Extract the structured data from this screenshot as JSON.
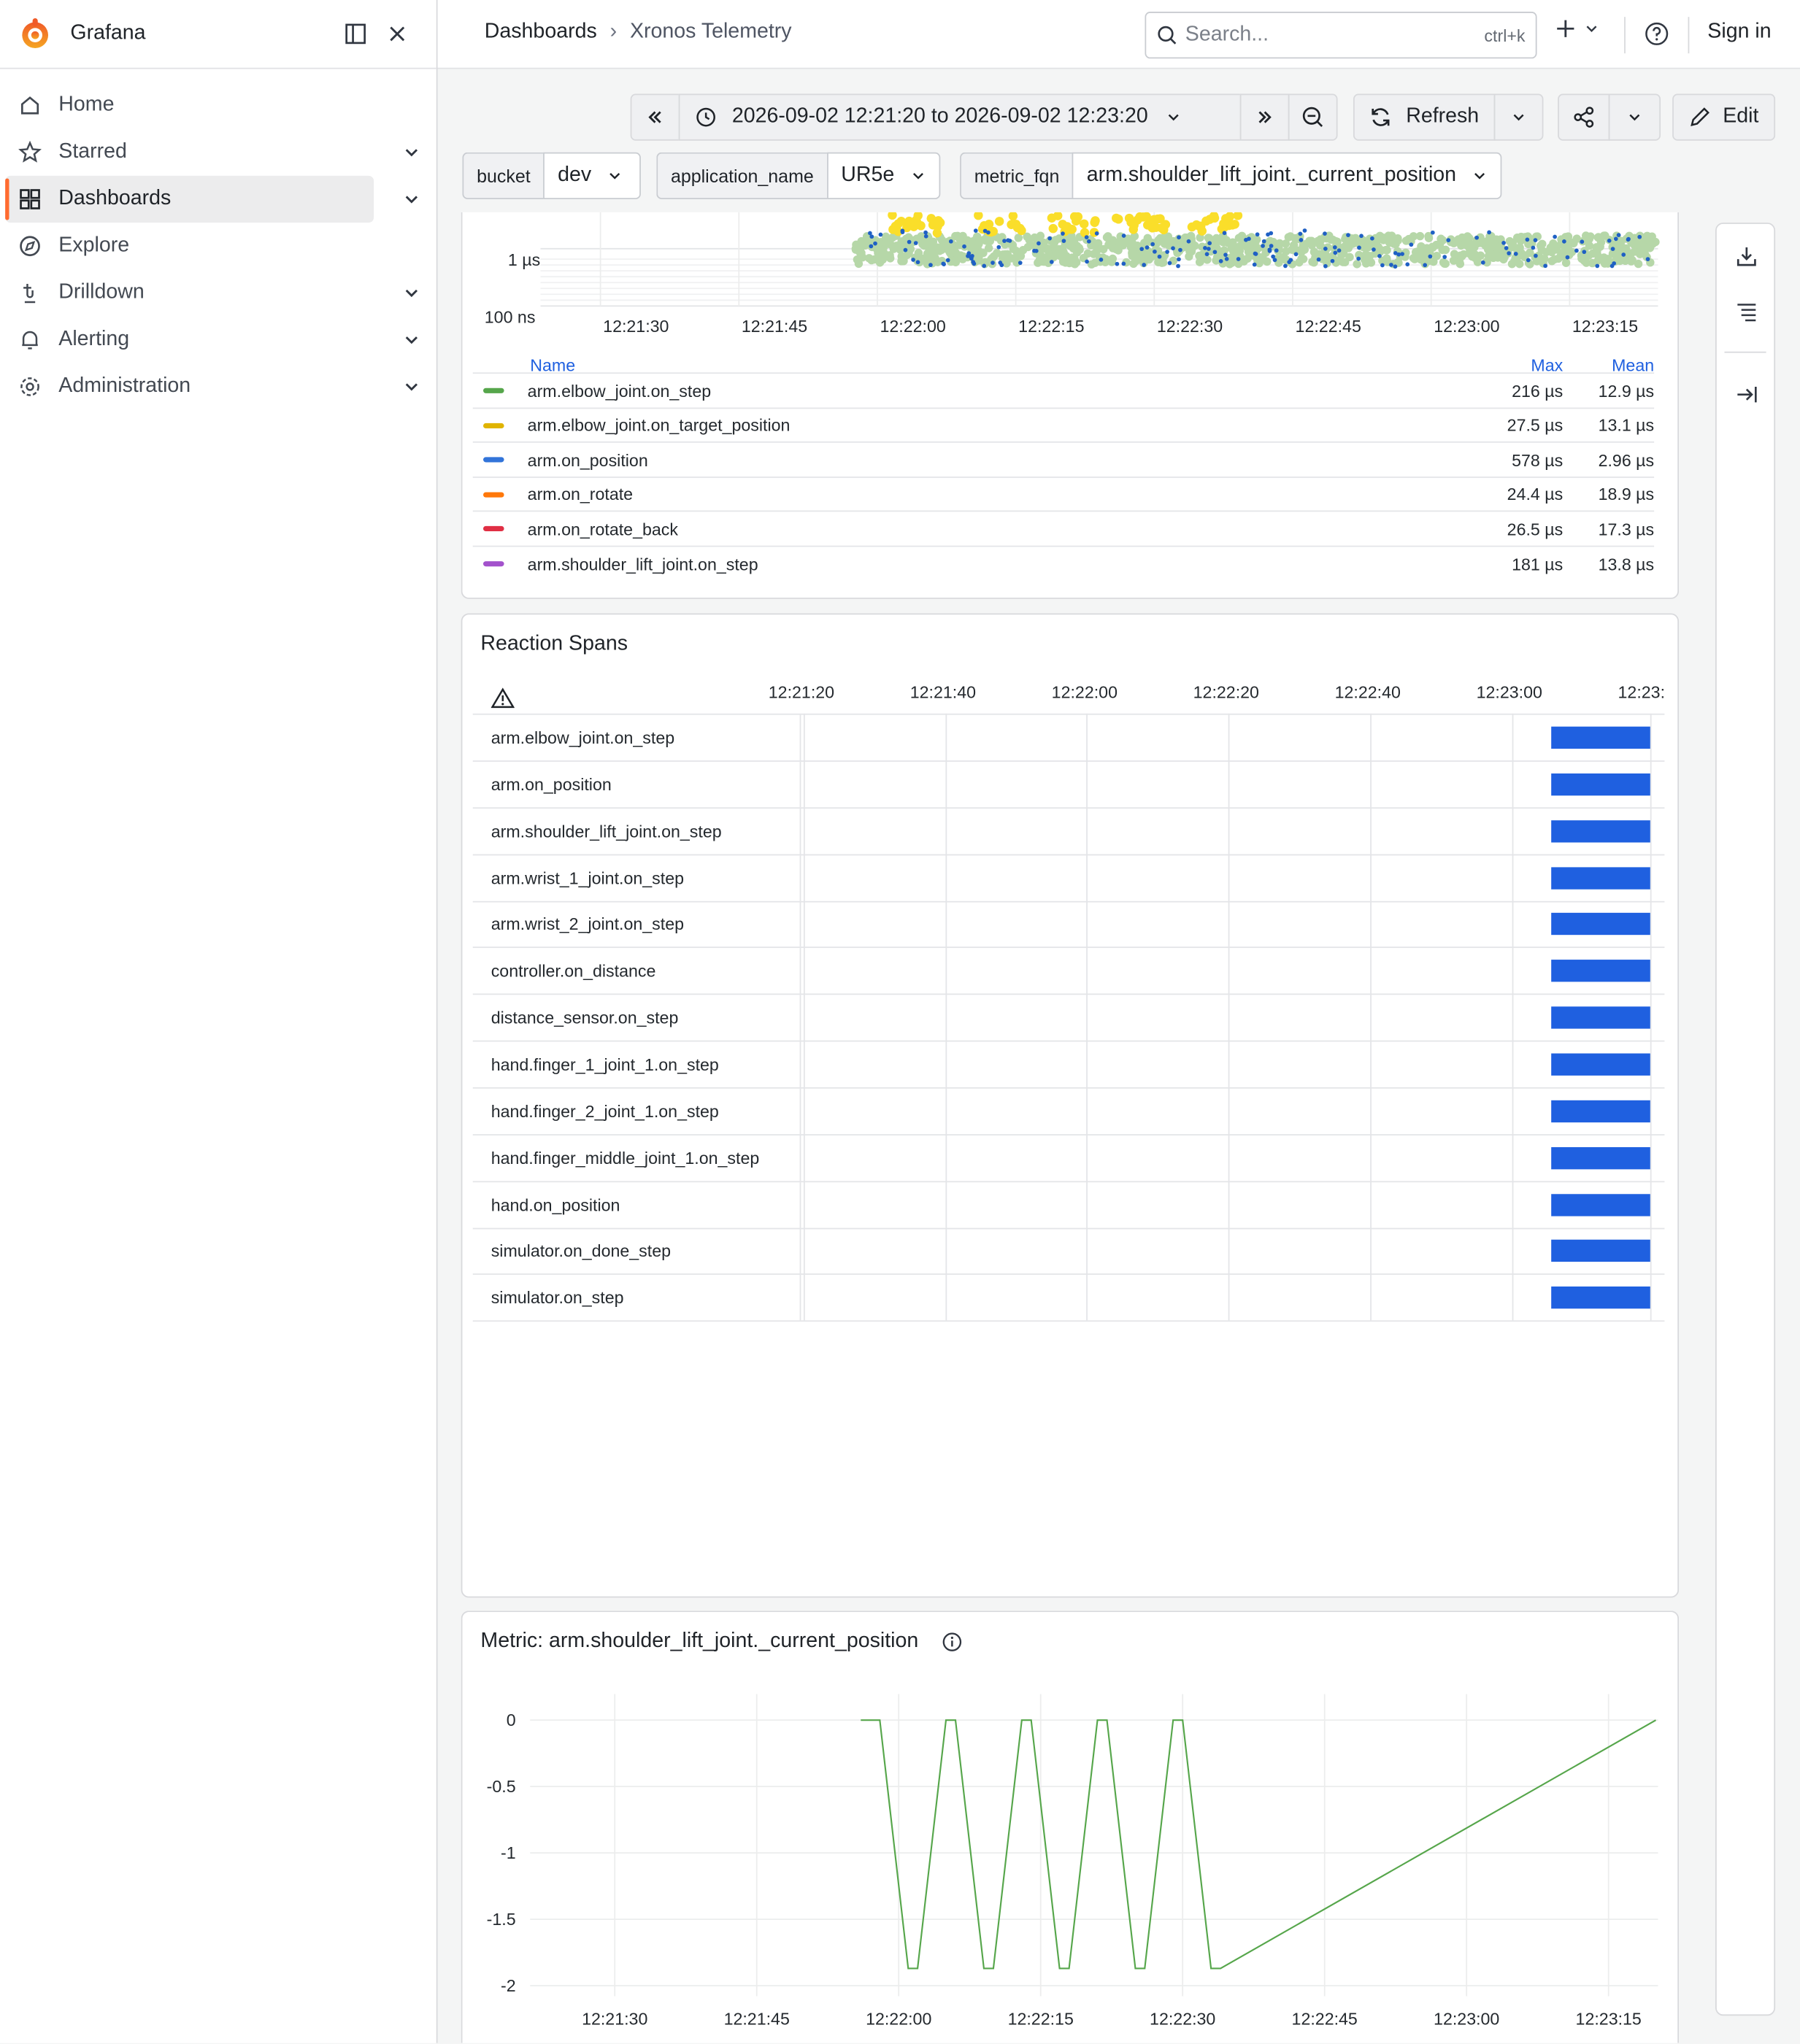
{
  "app": {
    "title": "Grafana"
  },
  "nav": {
    "items": [
      {
        "label": "Home",
        "icon": "home-icon"
      },
      {
        "label": "Starred",
        "icon": "star-icon"
      },
      {
        "label": "Dashboards",
        "icon": "dashboards-icon",
        "active": true
      },
      {
        "label": "Explore",
        "icon": "compass-icon"
      },
      {
        "label": "Drilldown",
        "icon": "drilldown-icon"
      },
      {
        "label": "Alerting",
        "icon": "bell-icon"
      },
      {
        "label": "Administration",
        "icon": "gear-icon"
      }
    ]
  },
  "topbar": {
    "breadcrumb_root": "Dashboards",
    "breadcrumb_separator": "›",
    "breadcrumb_current": "Xronos Telemetry",
    "search_placeholder": "Search...",
    "search_shortcut": "ctrl+k",
    "signin": "Sign in"
  },
  "toolbar": {
    "time_range": "2026-09-02 12:21:20 to 2026-09-02 12:23:20",
    "refresh_label": "Refresh",
    "edit_label": "Edit"
  },
  "variables": [
    {
      "label": "bucket",
      "value": "dev"
    },
    {
      "label": "application_name",
      "value": "UR5e"
    },
    {
      "label": "metric_fqn",
      "value": "arm.shoulder_lift_joint._current_position"
    }
  ],
  "scatter_panel": {
    "y_ticks": [
      "1 µs",
      "100 ns"
    ],
    "x_ticks": [
      "12:21:30",
      "12:21:45",
      "12:22:00",
      "12:22:15",
      "12:22:30",
      "12:22:45",
      "12:23:00",
      "12:23:15"
    ],
    "legend_headers": {
      "name": "Name",
      "max": "Max",
      "mean": "Mean"
    },
    "legend": [
      {
        "name": "arm.elbow_joint.on_step",
        "max": "216 µs",
        "mean": "12.9 µs",
        "color": "#56a64b"
      },
      {
        "name": "arm.elbow_joint.on_target_position",
        "max": "27.5 µs",
        "mean": "13.1 µs",
        "color": "#e0b400"
      },
      {
        "name": "arm.on_position",
        "max": "578 µs",
        "mean": "2.96 µs",
        "color": "#3274d9"
      },
      {
        "name": "arm.on_rotate",
        "max": "24.4 µs",
        "mean": "18.9 µs",
        "color": "#ff780a"
      },
      {
        "name": "arm.on_rotate_back",
        "max": "26.5 µs",
        "mean": "17.3 µs",
        "color": "#e02f44"
      },
      {
        "name": "arm.shoulder_lift_joint.on_step",
        "max": "181 µs",
        "mean": "13.8 µs",
        "color": "#a352cc"
      }
    ]
  },
  "spans_panel": {
    "title": "Reaction Spans",
    "x_ticks": [
      "12:21:20",
      "12:21:40",
      "12:22:00",
      "12:22:20",
      "12:22:40",
      "12:23:00",
      "12:23:"
    ],
    "rows": [
      "arm.elbow_joint.on_step",
      "arm.on_position",
      "arm.shoulder_lift_joint.on_step",
      "arm.wrist_1_joint.on_step",
      "arm.wrist_2_joint.on_step",
      "controller.on_distance",
      "distance_sensor.on_step",
      "hand.finger_1_joint_1.on_step",
      "hand.finger_2_joint_1.on_step",
      "hand.finger_middle_joint_1.on_step",
      "hand.on_position",
      "simulator.on_done_step",
      "simulator.on_step"
    ],
    "bar_color": "#1f60e0"
  },
  "metric_panel": {
    "title": "Metric: arm.shoulder_lift_joint._current_position",
    "line_color": "#56a64b"
  },
  "chart_data": [
    {
      "type": "scatter",
      "x_ticks": [
        "12:21:30",
        "12:21:45",
        "12:22:00",
        "12:22:15",
        "12:22:30",
        "12:22:45",
        "12:23:00",
        "12:23:15"
      ],
      "y_scale": "log",
      "y_ticks": [
        "100 ns",
        "1 µs"
      ],
      "series": [
        {
          "name": "arm.elbow_joint.on_step",
          "max": "216 µs",
          "mean": "12.9 µs"
        },
        {
          "name": "arm.elbow_joint.on_target_position",
          "max": "27.5 µs",
          "mean": "13.1 µs"
        },
        {
          "name": "arm.on_position",
          "max": "578 µs",
          "mean": "2.96 µs"
        },
        {
          "name": "arm.on_rotate",
          "max": "24.4 µs",
          "mean": "18.9 µs"
        },
        {
          "name": "arm.on_rotate_back",
          "max": "26.5 µs",
          "mean": "17.3 µs"
        },
        {
          "name": "arm.shoulder_lift_joint.on_step",
          "max": "181 µs",
          "mean": "13.8 µs"
        }
      ]
    },
    {
      "type": "line",
      "title": "Metric: arm.shoulder_lift_joint._current_position",
      "x_ticks": [
        "12:21:30",
        "12:21:45",
        "12:22:00",
        "12:22:15",
        "12:22:30",
        "12:22:45",
        "12:23:00",
        "12:23:15"
      ],
      "y_ticks": [
        "0",
        "-0.5",
        "-1",
        "-1.5",
        "-2"
      ],
      "ylim": [
        -2,
        0
      ],
      "x": [
        "12:21:56",
        "12:21:58",
        "12:22:01",
        "12:22:02",
        "12:22:05",
        "12:22:06",
        "12:22:09",
        "12:22:10",
        "12:22:13",
        "12:22:14",
        "12:22:17",
        "12:22:18",
        "12:22:21",
        "12:22:22",
        "12:22:25",
        "12:22:26",
        "12:22:29",
        "12:22:30",
        "12:22:33",
        "12:22:34",
        "12:23:20"
      ],
      "series": [
        {
          "values": [
            0,
            0,
            -1.87,
            -1.87,
            0,
            0,
            -1.87,
            -1.87,
            0,
            0,
            -1.87,
            -1.87,
            0,
            0,
            -1.87,
            -1.87,
            0,
            0,
            -1.87,
            -1.87,
            0
          ]
        }
      ]
    }
  ]
}
